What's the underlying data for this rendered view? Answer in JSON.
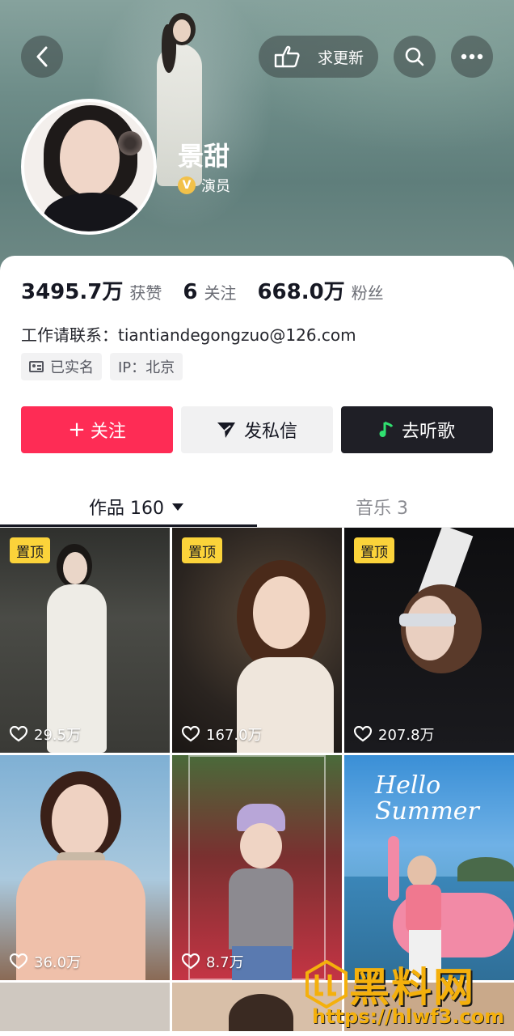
{
  "header": {
    "update_label": "求更新",
    "icons": {
      "back": "back-chevron-icon",
      "update": "pointing-hand-icon",
      "search": "search-icon",
      "more": "more-dots-icon"
    }
  },
  "profile": {
    "name": "景甜",
    "verified_badge": "V",
    "verified_label": "演员"
  },
  "stats": [
    {
      "value": "3495.7万",
      "label": "获赞"
    },
    {
      "value": "6",
      "label": "关注"
    },
    {
      "value": "668.0万",
      "label": "粉丝"
    }
  ],
  "contact": "工作请联系：tiantiandegongzuo@126.com",
  "tags": {
    "real_name": "已实名",
    "ip": "IP：北京"
  },
  "actions": {
    "follow": "关注",
    "follow_plus": "+",
    "message": "发私信",
    "listen": "去听歌"
  },
  "tabs": {
    "works": "作品 160",
    "music": "音乐 3"
  },
  "videos": [
    {
      "pinned": "置顶",
      "likes": "29.5万"
    },
    {
      "pinned": "置顶",
      "likes": "167.0万"
    },
    {
      "pinned": "置顶",
      "likes": "207.8万"
    },
    {
      "pinned": "",
      "likes": "36.0万"
    },
    {
      "pinned": "",
      "likes": "8.7万"
    },
    {
      "pinned": "",
      "likes": ""
    }
  ],
  "tile6_text": "Hello Summer",
  "watermark": {
    "title": "黑料网",
    "url": "https://hlwf3.com"
  },
  "colors": {
    "follow": "#fe2c55",
    "pin": "#fbd33a",
    "watermark": "#f4b00c",
    "dark_button": "#1f1f26"
  }
}
